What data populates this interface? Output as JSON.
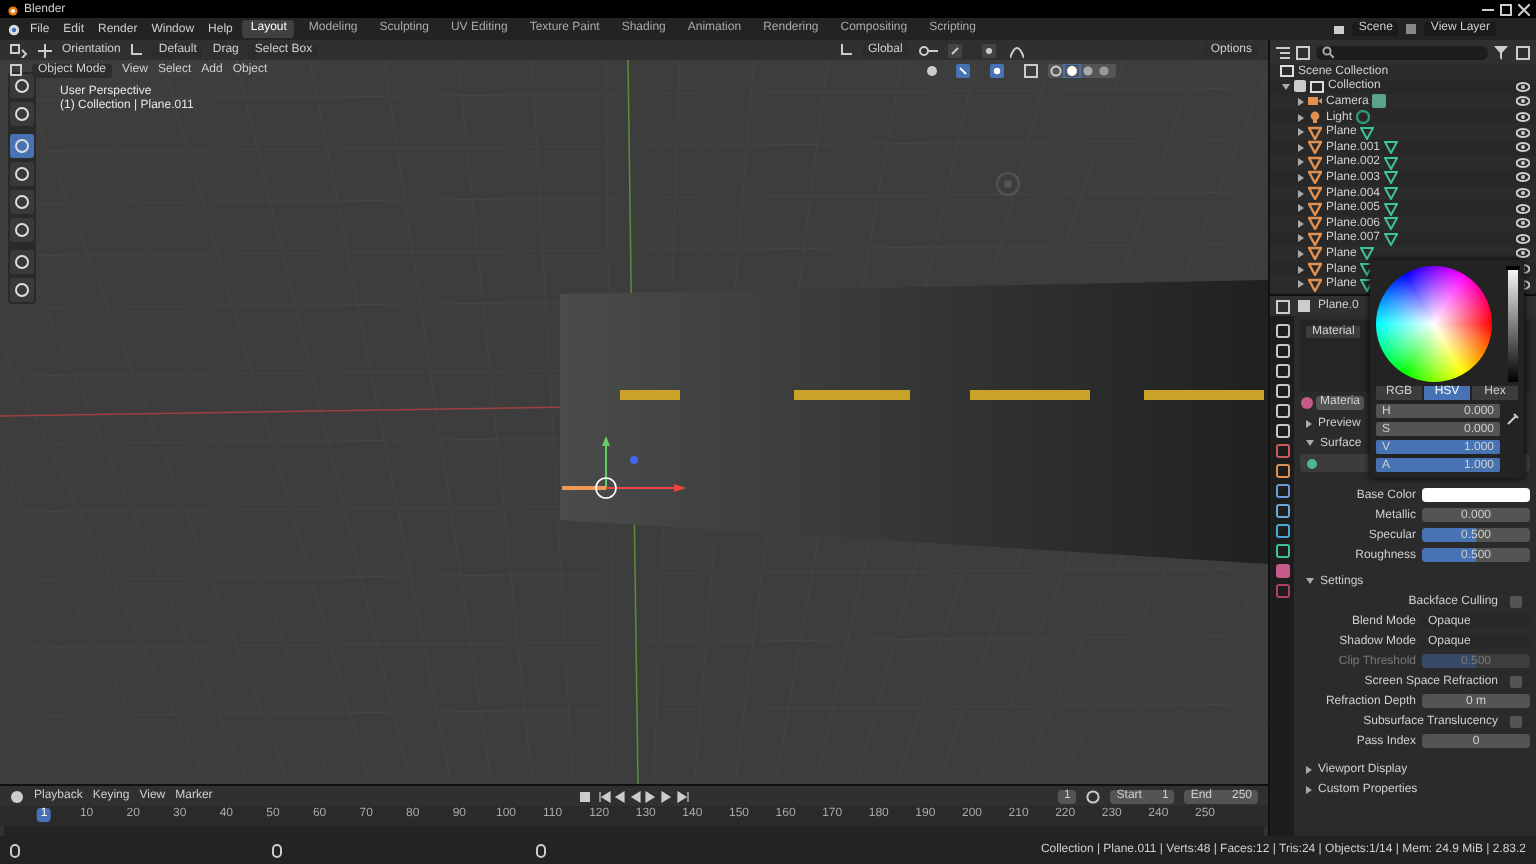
{
  "window": {
    "title": "Blender"
  },
  "menu": [
    "File",
    "Edit",
    "Render",
    "Window",
    "Help"
  ],
  "workspaces": [
    {
      "label": "Layout",
      "selected": true
    },
    {
      "label": "Modeling",
      "selected": false
    },
    {
      "label": "Sculpting",
      "selected": false
    },
    {
      "label": "UV Editing",
      "selected": false
    },
    {
      "label": "Texture Paint",
      "selected": false
    },
    {
      "label": "Shading",
      "selected": false
    },
    {
      "label": "Animation",
      "selected": false
    },
    {
      "label": "Rendering",
      "selected": false
    },
    {
      "label": "Compositing",
      "selected": false
    },
    {
      "label": "Scripting",
      "selected": false
    }
  ],
  "scene": "Scene",
  "view_layer": "View Layer",
  "tool_header": {
    "orientation_label": "Orientation",
    "orientation": "Default",
    "drag_label": "Drag",
    "select": "Select Box",
    "transform": "Global",
    "options": "Options"
  },
  "viewport": {
    "mode": "Object Mode",
    "menus": [
      "View",
      "Select",
      "Add",
      "Object"
    ],
    "overlay_title": "User Perspective",
    "overlay_info": "(1) Collection | Plane.011"
  },
  "outliner": {
    "root": "Scene Collection",
    "items": [
      {
        "label": "Collection",
        "kind": "collection",
        "expanded": true,
        "children": [
          {
            "label": "Camera",
            "kind": "camera",
            "expanded": false
          },
          {
            "label": "Light",
            "kind": "light",
            "expanded": false
          },
          {
            "label": "Plane",
            "kind": "mesh",
            "expanded": false
          },
          {
            "label": "Plane.001",
            "kind": "mesh",
            "expanded": false
          },
          {
            "label": "Plane.002",
            "kind": "mesh",
            "expanded": false
          },
          {
            "label": "Plane.003",
            "kind": "mesh",
            "expanded": false
          },
          {
            "label": "Plane.004",
            "kind": "mesh",
            "expanded": false
          },
          {
            "label": "Plane.005",
            "kind": "mesh",
            "expanded": false
          },
          {
            "label": "Plane.006",
            "kind": "mesh",
            "expanded": false
          },
          {
            "label": "Plane.007",
            "kind": "mesh",
            "expanded": false
          },
          {
            "label": "Plane",
            "kind": "mesh",
            "expanded": false
          },
          {
            "label": "Plane",
            "kind": "mesh",
            "expanded": false
          },
          {
            "label": "Plane",
            "kind": "mesh",
            "expanded": false
          }
        ]
      }
    ]
  },
  "properties": {
    "object": "Plane.0",
    "slot": "Material",
    "material": "Materia",
    "sections": [
      {
        "label": "Preview",
        "expanded": false
      },
      {
        "label": "Surface",
        "expanded": true,
        "rows": [
          {
            "kind": "color",
            "label": "Base Color"
          },
          {
            "kind": "slider",
            "label": "Metallic",
            "value": "0.000",
            "level": 0
          },
          {
            "kind": "slider",
            "label": "Specular",
            "value": "0.500",
            "level": 0.5
          },
          {
            "kind": "slider",
            "label": "Roughness",
            "value": "0.500",
            "level": 0.5
          }
        ]
      },
      {
        "label": "Settings",
        "expanded": true,
        "rows": [
          {
            "kind": "checkbox",
            "label": "Backface Culling",
            "checked": false
          },
          {
            "kind": "select",
            "label": "Blend Mode",
            "value": "Opaque"
          },
          {
            "kind": "select",
            "label": "Shadow Mode",
            "value": "Opaque"
          },
          {
            "kind": "slider",
            "label": "Clip Threshold",
            "value": "0.500",
            "level": 0.5,
            "disabled": true
          },
          {
            "kind": "checkbox",
            "label": "Screen Space Refraction",
            "checked": false
          },
          {
            "kind": "number",
            "label": "Refraction Depth",
            "value": "0 m"
          },
          {
            "kind": "checkbox",
            "label": "Subsurface Translucency",
            "checked": false
          },
          {
            "kind": "number",
            "label": "Pass Index",
            "value": "0"
          }
        ]
      },
      {
        "label": "Viewport Display",
        "expanded": false
      },
      {
        "label": "Custom Properties",
        "expanded": false
      }
    ]
  },
  "color_picker": {
    "brightness": {
      "level": 1
    },
    "modes": [
      {
        "label": "RGB",
        "selected": false
      },
      {
        "label": "HSV",
        "selected": true
      },
      {
        "label": "Hex",
        "selected": false
      }
    ],
    "fields": [
      {
        "label": "H",
        "value": "0.000",
        "level": 0
      },
      {
        "label": "S",
        "value": "0.000",
        "level": 0
      },
      {
        "label": "V",
        "value": "1.000",
        "level": 1
      },
      {
        "label": "A",
        "value": "1.000",
        "level": 1
      }
    ]
  },
  "timeline": {
    "menus": [
      "Playback",
      "Keying",
      "View",
      "Marker"
    ],
    "current_frame": "1",
    "start_label": "Start",
    "start": "1",
    "end_label": "End",
    "end": "250",
    "ticks": [
      {
        "label": "1",
        "selected": true
      },
      {
        "label": "10",
        "selected": false
      },
      {
        "label": "20",
        "selected": false
      },
      {
        "label": "30",
        "selected": false
      },
      {
        "label": "40",
        "selected": false
      },
      {
        "label": "50",
        "selected": false
      },
      {
        "label": "60",
        "selected": false
      },
      {
        "label": "70",
        "selected": false
      },
      {
        "label": "80",
        "selected": false
      },
      {
        "label": "90",
        "selected": false
      },
      {
        "label": "100",
        "selected": false
      },
      {
        "label": "110",
        "selected": false
      },
      {
        "label": "120",
        "selected": false
      },
      {
        "label": "130",
        "selected": false
      },
      {
        "label": "140",
        "selected": false
      },
      {
        "label": "150",
        "selected": false
      },
      {
        "label": "160",
        "selected": false
      },
      {
        "label": "170",
        "selected": false
      },
      {
        "label": "180",
        "selected": false
      },
      {
        "label": "190",
        "selected": false
      },
      {
        "label": "200",
        "selected": false
      },
      {
        "label": "210",
        "selected": false
      },
      {
        "label": "220",
        "selected": false
      },
      {
        "label": "230",
        "selected": false
      },
      {
        "label": "240",
        "selected": false
      },
      {
        "label": "250",
        "selected": false
      }
    ]
  },
  "status_bar": "Collection | Plane.011 | Verts:48 | Faces:12 | Tris:24 | Objects:1/14 | Mem: 24.9 MiB | 2.83.2"
}
